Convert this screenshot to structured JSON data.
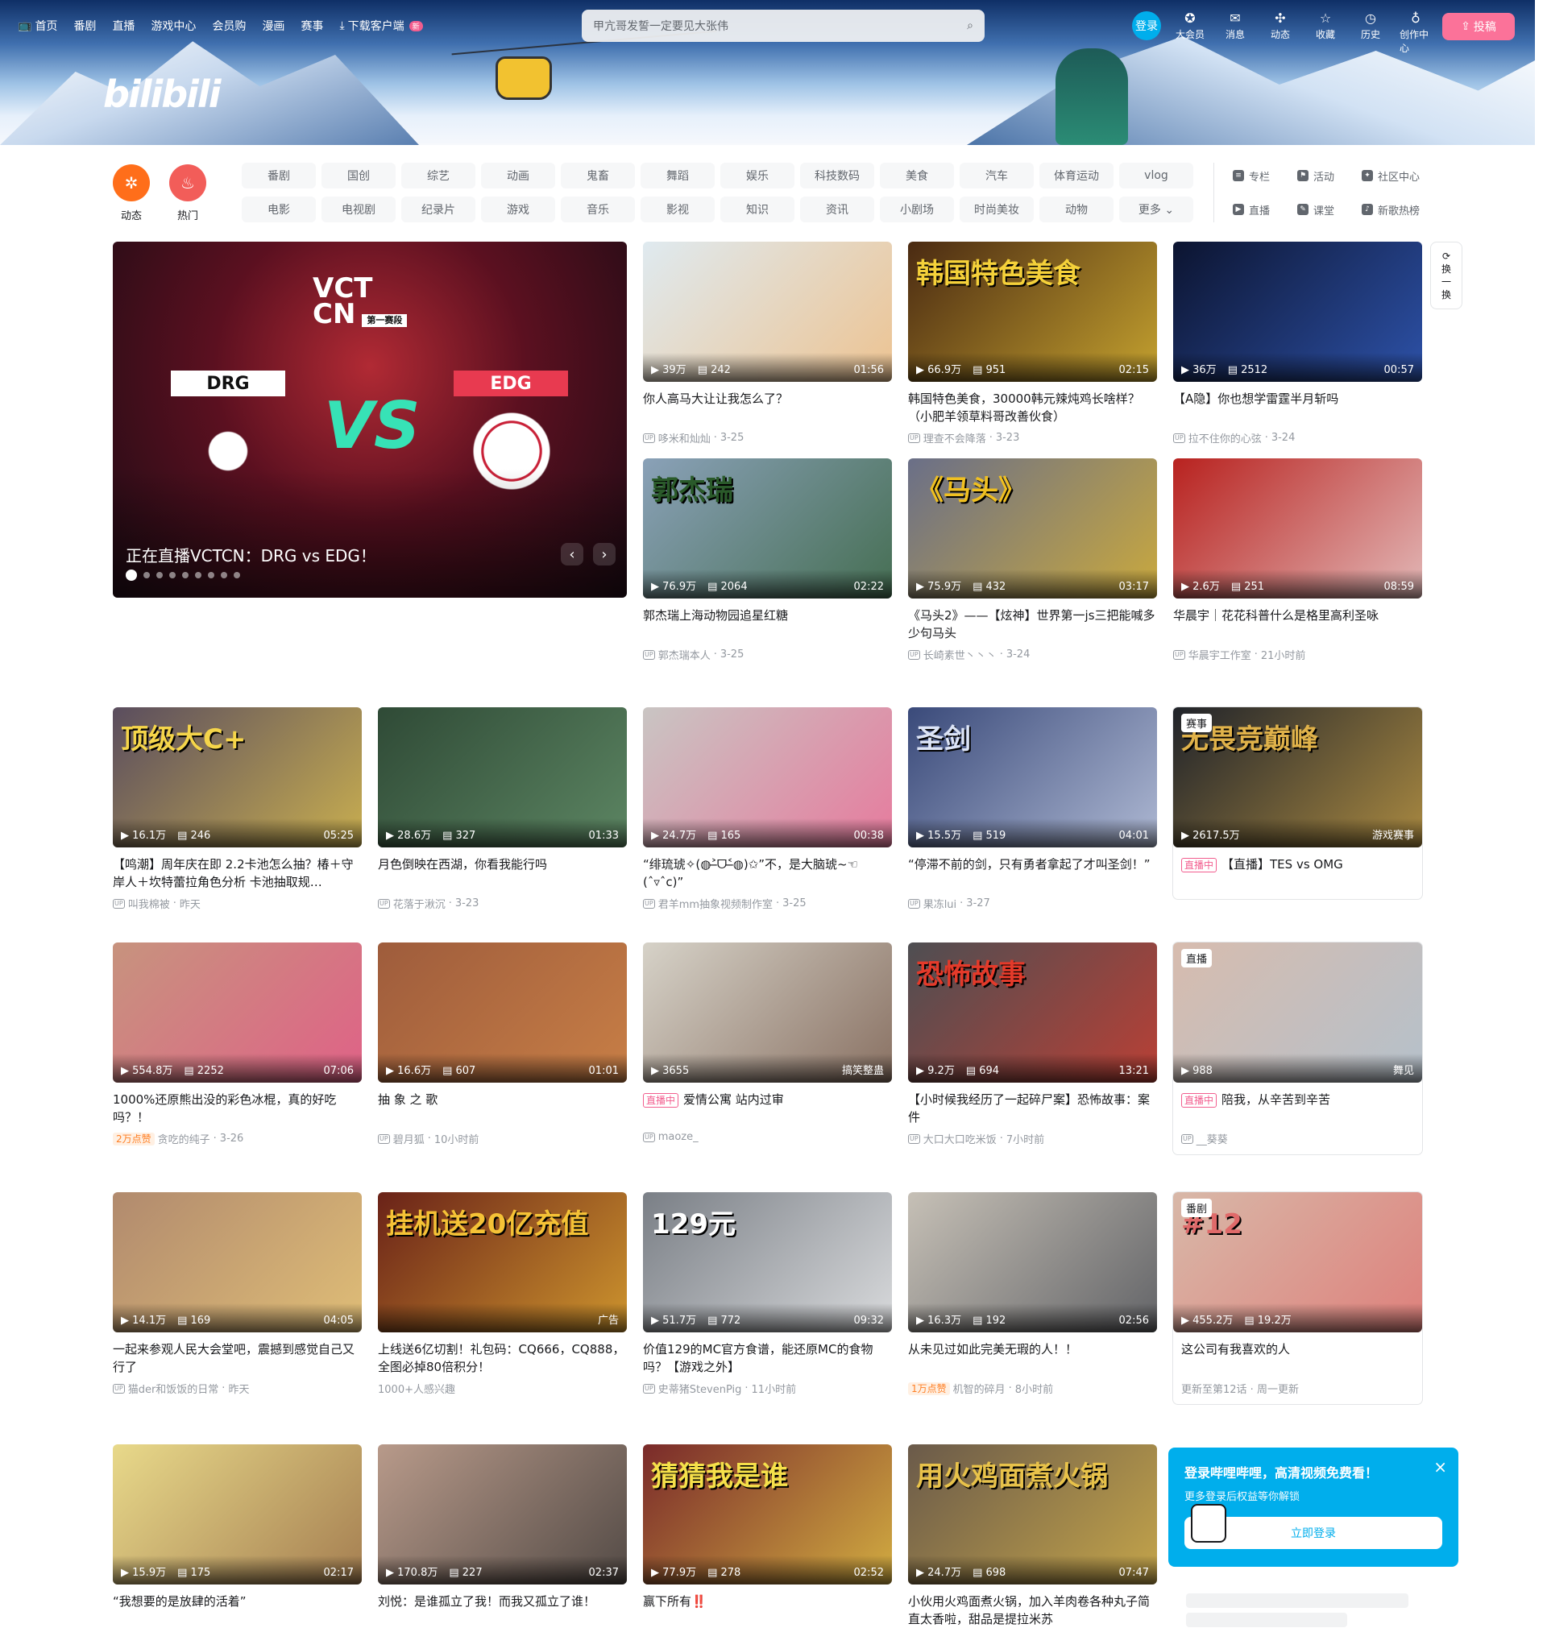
{
  "header": {
    "nav_left": [
      "首页",
      "番剧",
      "直播",
      "游戏中心",
      "会员购",
      "漫画",
      "赛事",
      "下载客户端"
    ],
    "new_badge": "新",
    "logo_text": "bilibili",
    "search_placeholder": "甲亢哥发誓一定要见大张伟",
    "login": "登录",
    "nav_right": [
      "大会员",
      "消息",
      "动态",
      "收藏",
      "历史",
      "创作中心"
    ],
    "upload": "投稿"
  },
  "channels": {
    "dynamic": "动态",
    "hot": "热门",
    "grid": [
      "番剧",
      "国创",
      "综艺",
      "动画",
      "鬼畜",
      "舞蹈",
      "娱乐",
      "科技数码",
      "美食",
      "汽车",
      "体育运动",
      "vlog",
      "电影",
      "电视剧",
      "纪录片",
      "游戏",
      "音乐",
      "影视",
      "知识",
      "资讯",
      "小剧场",
      "时尚美妆",
      "动物",
      "更多"
    ],
    "side": [
      "专栏",
      "活动",
      "社区中心",
      "直播",
      "课堂",
      "新歌热榜"
    ],
    "colors": {
      "dynamic": "#ff6e1a",
      "hot": "#f25d59"
    }
  },
  "carousel": {
    "title": "正在直播VCTCN：DRG vs EDG！",
    "vct": "VCT",
    "cn": "CN",
    "stage": "第一赛段",
    "team_a": "DRG",
    "team_b": "EDG",
    "vs": "VS"
  },
  "refresh": [
    "换",
    "一",
    "换"
  ],
  "videos": [
    {
      "plays": "39万",
      "danmaku": "242",
      "dur": "01:56",
      "title": "你人高马大让让我怎么了？",
      "owner": "哆米和灿灿",
      "date": "3-25",
      "bg": "#dfeaf0",
      "accent": "#f2b36b"
    },
    {
      "plays": "66.9万",
      "danmaku": "951",
      "dur": "02:15",
      "title": "韩国特色美食，30000韩元辣炖鸡长啥样？（小肥羊领草料哥改善伙食）",
      "owner": "理查不会降落",
      "date": "3-23",
      "bg": "#4a2a12",
      "accent": "#f5d13a",
      "overlay": "韩国特色美食"
    },
    {
      "plays": "36万",
      "danmaku": "2512",
      "dur": "00:57",
      "title": "【A隐】你也想学雷霆半月斩吗",
      "owner": "拉不住你的心弦",
      "date": "3-24",
      "bg": "#0c1430",
      "accent": "#3a6ad8"
    },
    {
      "plays": "76.9万",
      "danmaku": "2064",
      "dur": "02:22",
      "title": "郭杰瑞上海动物园追星红糖",
      "owner": "郭杰瑞本人",
      "date": "3-25",
      "bg": "#8aa1b8",
      "accent": "#2a5a2a",
      "overlay": "郭杰瑞"
    },
    {
      "plays": "75.9万",
      "danmaku": "432",
      "dur": "03:17",
      "title": "《马头2》——【炫神】世界第一js三把能喊多少句马头",
      "owner": "长崎素世丶丶丶",
      "date": "3-24",
      "bg": "#6a6f88",
      "accent": "#f0c020",
      "overlay": "《马头》"
    },
    {
      "plays": "2.6万",
      "danmaku": "251",
      "dur": "08:59",
      "title": "华晨宇｜花花科普什么是格里高利圣咏",
      "owner": "华晨宇工作室",
      "date": "21小时前",
      "bg": "#b8221f",
      "accent": "#f3f3f3"
    },
    {
      "plays": "16.1万",
      "danmaku": "246",
      "dur": "05:25",
      "title": "【鸣潮】周年庆在即 2.2卡池怎么抽？椿＋守岸人＋坎特蕾拉角色分析 卡池抽取规…",
      "owner": "叫我棉被",
      "date": "昨天",
      "bg": "#5a4d5e",
      "accent": "#f5d54a",
      "overlay": "顶级大C+"
    },
    {
      "plays": "28.6万",
      "danmaku": "327",
      "dur": "01:33",
      "title": "月色倒映在西湖，你看我能行吗",
      "owner": "花落于湫沉",
      "date": "3-23",
      "bg": "#2f4a36",
      "accent": "#6e9d74"
    },
    {
      "plays": "24.7万",
      "danmaku": "165",
      "dur": "00:38",
      "title": "“绯琉琥✧(◍˃̶ᗜ˂̶◍)✩”不，是大脑琥~☜(ˆ▿ˆc)”",
      "owner": "君羊mm抽象视频制作室",
      "date": "3-25",
      "bg": "#c9c5c3",
      "accent": "#f25d8e"
    },
    {
      "plays": "15.5万",
      "danmaku": "519",
      "dur": "04:01",
      "title": "“停滞不前的剑，只有勇者拿起了才叫圣剑！”",
      "owner": "果冻lui",
      "date": "3-27",
      "bg": "#3a4a7a",
      "accent": "#dce4f6",
      "overlay": "圣剑"
    },
    {
      "tag": "赛事",
      "plays": "2617.5万",
      "cat": "游戏赛事",
      "title": "【直播】TES vs OMG",
      "live": "直播中",
      "bg": "#20232a",
      "accent": "#e0b24a",
      "overlay": "无畏竞巅峰"
    },
    {
      "plays": "554.8万",
      "danmaku": "2252",
      "dur": "07:06",
      "title": "1000%还原熊出没的彩色冰棍，真的好吃吗？！",
      "likes": "2万点赞",
      "owner": "贪吃的纯子",
      "date": "3-26",
      "bg": "#c7937e",
      "accent": "#e94e8a"
    },
    {
      "plays": "16.6万",
      "danmaku": "607",
      "dur": "01:01",
      "title": "抽 象 之 歌",
      "owner": "碧月狐",
      "date": "10小时前",
      "bg": "#9e5c3c",
      "accent": "#d88c4a"
    },
    {
      "plays": "3655",
      "cat": "搞笑整蛊",
      "title": "爱情公寓 站内过审",
      "live": "直播中",
      "owner": "maoze_",
      "bg": "#d6d2c8",
      "accent": "#6a4a3a"
    },
    {
      "plays": "9.2万",
      "danmaku": "694",
      "dur": "13:21",
      "title": "【小时候我经历了一起碎尸案】恐怖故事：案件",
      "owner": "大口大口吃米饭",
      "date": "7小时前",
      "bg": "#4e4e52",
      "accent": "#e43a2a",
      "overlay": "恐怖故事"
    },
    {
      "tag": "直播",
      "plays": "988",
      "cat": "舞见",
      "title": "陪我，从辛苦到辛苦",
      "live": "直播中",
      "owner": "__葵葵",
      "bg": "#d7bcae",
      "accent": "#a7c2d6"
    },
    {
      "plays": "14.1万",
      "danmaku": "169",
      "dur": "04:05",
      "title": "一起来参观人民大会堂吧，震撼到感觉自己又行了",
      "owner": "猫der和饭饭的日常",
      "date": "昨天",
      "bg": "#b18a6e",
      "accent": "#f2d27a"
    },
    {
      "plays": "",
      "danmaku": "",
      "dur": "广告",
      "title": "上线送6亿切割！礼包码：CQ666，CQ888，全图必掉80倍积分！",
      "owner": "1000+人感兴趣",
      "bg": "#6a2218",
      "accent": "#f5c236",
      "overlay": "挂机送20亿充值"
    },
    {
      "plays": "51.7万",
      "danmaku": "772",
      "dur": "09:32",
      "title": "价值129的MC官方食谱，能还原MC的食物吗？【游戏之外】",
      "owner": "史蒂猪StevenPig",
      "date": "11小时前",
      "bg": "#7a7f86",
      "accent": "#ffffff",
      "overlay": "129元"
    },
    {
      "plays": "16.3万",
      "danmaku": "192",
      "dur": "02:56",
      "title": "从未见过如此完美无瑕的人！！",
      "likes": "1万点赞",
      "owner": "机智的碎月",
      "date": "8小时前",
      "bg": "#c6c0b6",
      "accent": "#3b3f48"
    },
    {
      "tag": "番剧",
      "plays": "455.2万",
      "danmaku": "19.2万",
      "title": "这公司有我喜欢的人",
      "owner": "更新至第12话 · 周一更新",
      "bg": "#d8b8a8",
      "accent": "#e06a6a",
      "overlay": "#12"
    },
    {
      "plays": "15.9万",
      "danmaku": "175",
      "dur": "02:17",
      "title": "“我想要的是放肆的活着”",
      "bg": "#e8d98a",
      "accent": "#8a5a3a"
    },
    {
      "plays": "170.8万",
      "danmaku": "227",
      "dur": "02:37",
      "title": "刘悦：是谁孤立了我！而我又孤立了谁！",
      "bg": "#b89a8a",
      "accent": "#2a2a2a"
    },
    {
      "plays": "77.9万",
      "danmaku": "278",
      "dur": "02:52",
      "title": "赢下所有‼️",
      "bg": "#7a2a2a",
      "accent": "#f5e04a",
      "overlay": "猜猜我是谁"
    },
    {
      "plays": "24.7万",
      "danmaku": "698",
      "dur": "07:47",
      "title": "小伙用火鸡面煮火锅，加入羊肉卷各种丸子简直太香啦，甜品是提拉米苏",
      "bg": "#6a5a4a",
      "accent": "#e8c24a",
      "overlay": "用火鸡面煮火锅"
    }
  ],
  "popup": {
    "title": "登录哔哩哔哩，高清视频免费看！",
    "subtitle": "更多登录后权益等你解锁",
    "button": "立即登录"
  }
}
